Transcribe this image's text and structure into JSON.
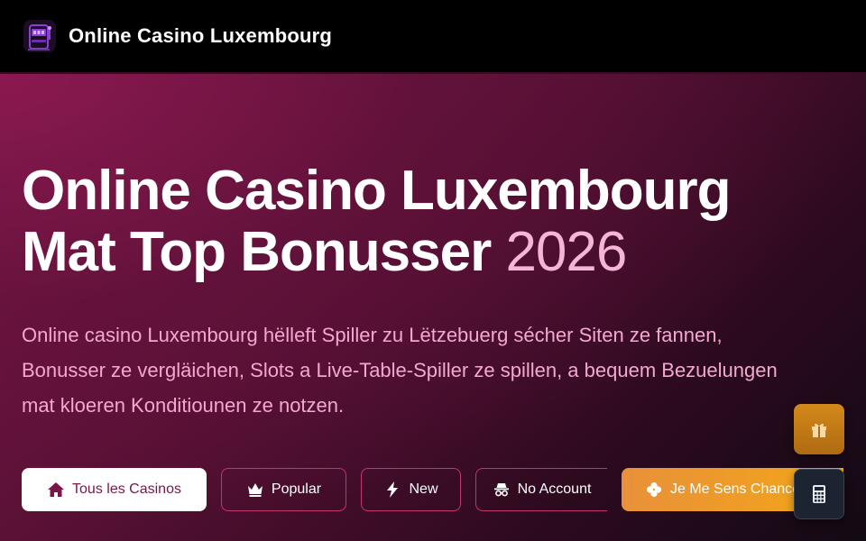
{
  "header": {
    "site_title": "Online Casino Luxembourg",
    "logo_icon": "slot-machine-icon"
  },
  "hero": {
    "title_line1": "Online Casino Luxembourg",
    "title_line2": "Mat Top Bonusser",
    "title_year": "2026",
    "description": "Online casino Luxembourg hëlleft Spiller zu Lëtzebuerg sécher Siten ze fannen, Bonusser ze vergläichen, Slots a Live-Table-Spiller ze spillen, a bequem Bezuelungen mat kloeren Konditiounen ze notzen."
  },
  "filters": [
    {
      "label": "Tous les Casinos",
      "icon": "home-icon",
      "active": true
    },
    {
      "label": "Popular",
      "icon": "crown-icon",
      "active": false
    },
    {
      "label": "New",
      "icon": "lightning-icon",
      "active": false
    },
    {
      "label": "No Account",
      "icon": "incognito-icon",
      "active": false
    },
    {
      "label": "Je Me Sens Chanceux",
      "icon": "clover-icon",
      "active": false
    }
  ],
  "floating": {
    "gift_icon": "gift-icon",
    "calculator_icon": "calculator-icon"
  },
  "colors": {
    "accent_pink": "#f3a8d0",
    "brand_wine": "#7a1748",
    "lucky_orange": "#f0a020"
  }
}
